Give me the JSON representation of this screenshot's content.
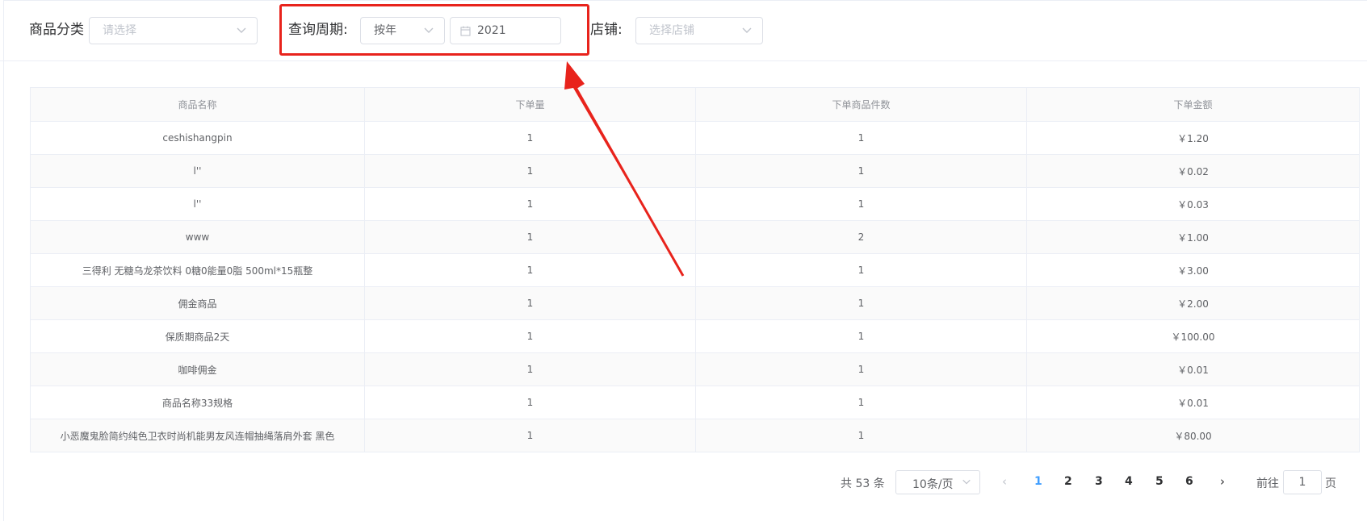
{
  "filters": {
    "category_label": "商品分类",
    "category_placeholder": "请选择",
    "period_label": "查询周期:",
    "period_value": "按年",
    "date_value": "2021",
    "store_label": "店铺:",
    "store_placeholder": "选择店铺"
  },
  "table": {
    "columns": [
      "商品名称",
      "下单量",
      "下单商品件数",
      "下单金额"
    ],
    "rows": [
      [
        "ceshishangpin",
        "1",
        "1",
        "￥1.20"
      ],
      [
        "l''",
        "1",
        "1",
        "￥0.02"
      ],
      [
        "l''",
        "1",
        "1",
        "￥0.03"
      ],
      [
        "www",
        "1",
        "2",
        "￥1.00"
      ],
      [
        "三得利 无糖乌龙茶饮料 0糖0能量0脂 500ml*15瓶整",
        "1",
        "1",
        "￥3.00"
      ],
      [
        "佣金商品",
        "1",
        "1",
        "￥2.00"
      ],
      [
        "保质期商品2天",
        "1",
        "1",
        "￥100.00"
      ],
      [
        "咖啡佣金",
        "1",
        "1",
        "￥0.01"
      ],
      [
        "商品名称33规格",
        "1",
        "1",
        "￥0.01"
      ],
      [
        "小恶魔鬼脸简约纯色卫衣时尚机能男友风连帽抽绳落肩外套 黑色",
        "1",
        "1",
        "￥80.00"
      ]
    ]
  },
  "pagination": {
    "total": "共 53 条",
    "page_size": "10条/页",
    "pages": [
      "1",
      "2",
      "3",
      "4",
      "5",
      "6"
    ],
    "active_page": "1",
    "goto_prefix": "前往",
    "goto_value": "1",
    "goto_suffix": "页"
  },
  "colors": {
    "accent": "#409eff",
    "annotation": "#e8231c"
  }
}
